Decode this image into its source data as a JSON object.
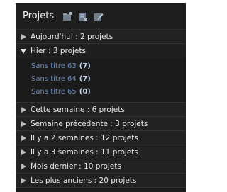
{
  "panel": {
    "title": "Projets",
    "toolbar_icons": [
      "new-folder-icon",
      "delete-icon",
      "edit-icon"
    ]
  },
  "groups": [
    {
      "label": "Aujourd'hui : 2 projets",
      "expanded": false
    },
    {
      "label": "Hier : 3 projets",
      "expanded": true,
      "children": [
        {
          "name": "Sans titre 63",
          "count": "(7)"
        },
        {
          "name": "Sans titre 64",
          "count": "(7)"
        },
        {
          "name": "Sans titre 65",
          "count": "(0)"
        }
      ]
    },
    {
      "label": "Cette semaine : 6 projets",
      "expanded": false
    },
    {
      "label": "Semaine précédente : 3 projets",
      "expanded": false
    },
    {
      "label": "Il y a 2 semaines : 12 projets",
      "expanded": false
    },
    {
      "label": "Il y a 3 semaines : 11 projets",
      "expanded": false
    },
    {
      "label": "Mois dernier : 10 projets",
      "expanded": false
    },
    {
      "label": "Les plus anciens : 20 projets",
      "expanded": false
    }
  ],
  "colors": {
    "background": "#1b1b1b",
    "row": "#222222",
    "child_text": "#6a8ab8",
    "count_text": "#c3d3ee"
  }
}
